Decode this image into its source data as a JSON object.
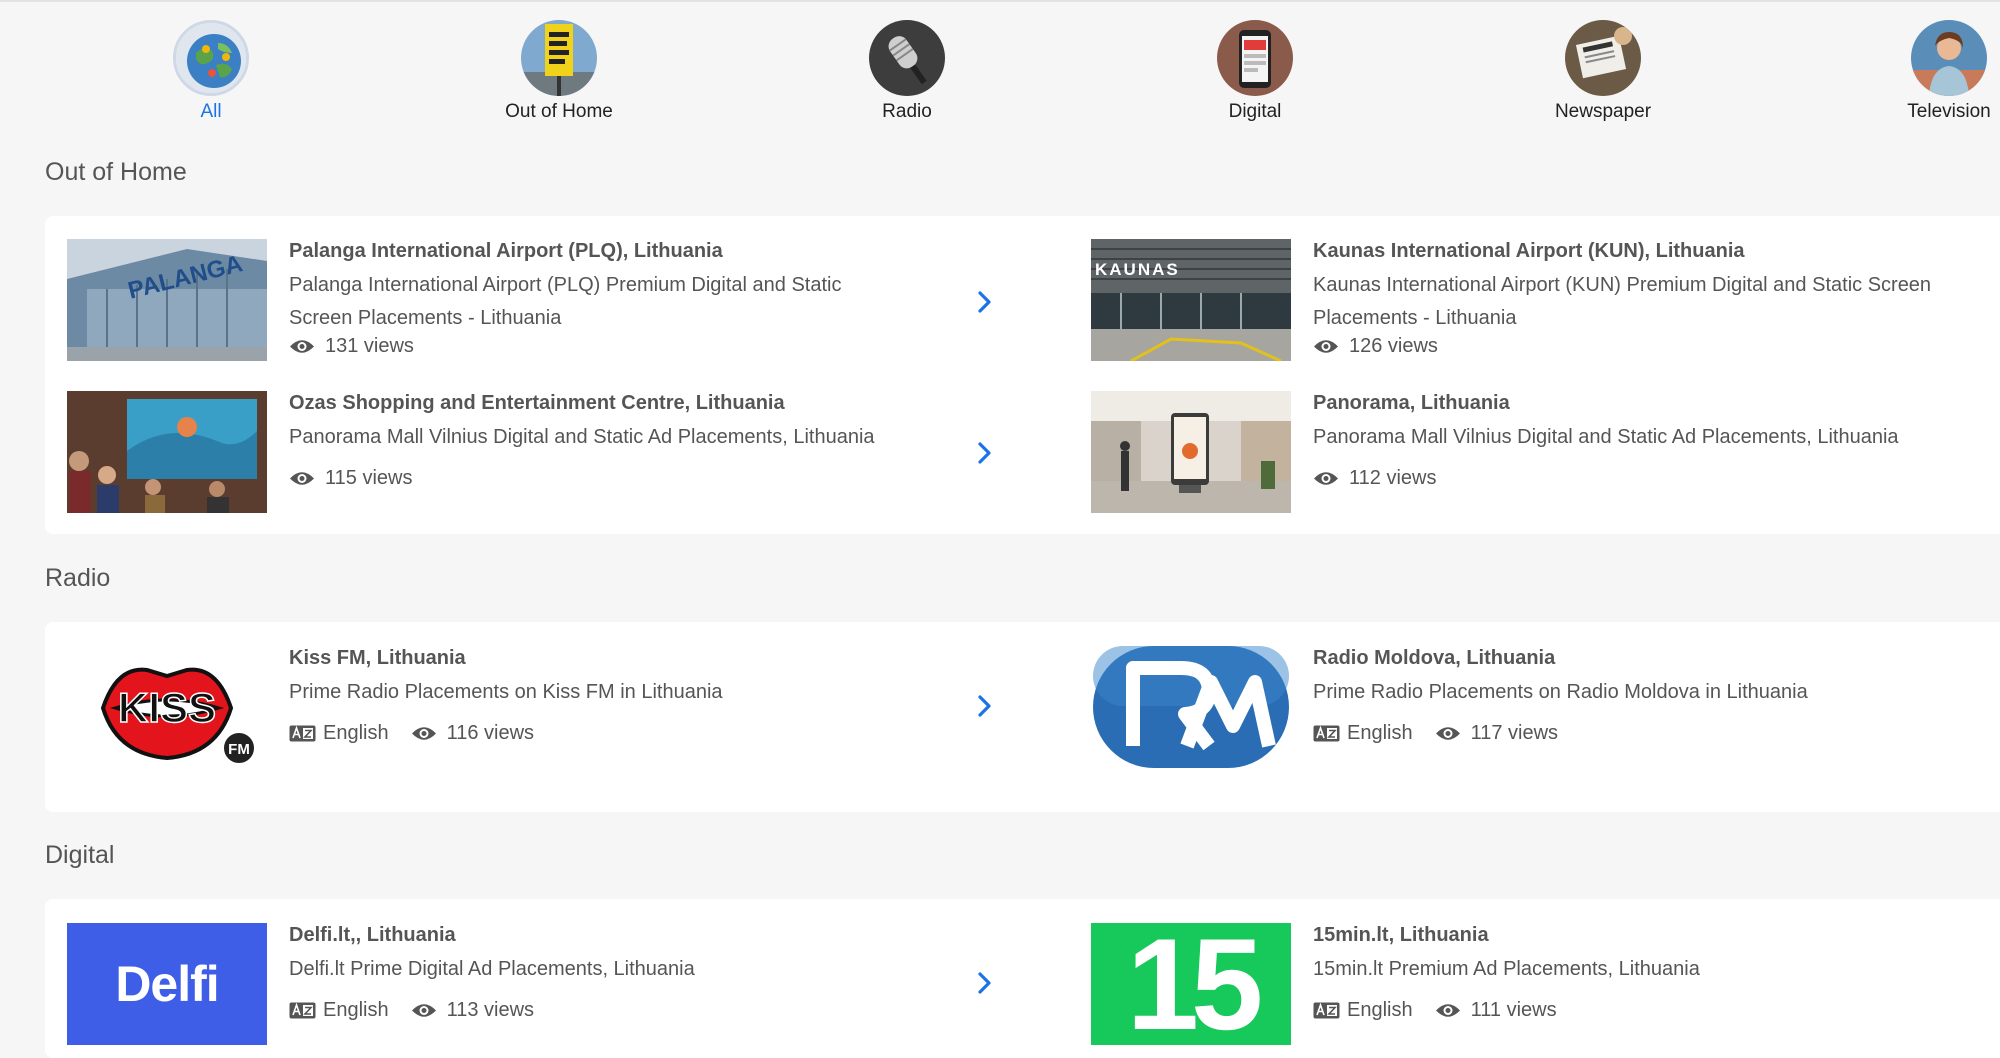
{
  "categories": [
    {
      "label": "All",
      "icon": "globe-icon",
      "active": true
    },
    {
      "label": "Out of Home",
      "icon": "billboard-icon",
      "active": false
    },
    {
      "label": "Radio",
      "icon": "microphone-icon",
      "active": false
    },
    {
      "label": "Digital",
      "icon": "phone-icon",
      "active": false
    },
    {
      "label": "Newspaper",
      "icon": "newspaper-icon",
      "active": false
    },
    {
      "label": "Television",
      "icon": "tv-presenter-icon",
      "active": false
    }
  ],
  "sections": {
    "ooh": {
      "title": "Out of Home",
      "items": [
        {
          "title": "Palanga International Airport (PLQ), Lithuania",
          "desc": "Palanga International Airport (PLQ) Premium Digital and Static Screen Placements - Lithuania",
          "views": "131 views",
          "image_text": "PALANGA"
        },
        {
          "title": "Kaunas International Airport (KUN), Lithuania",
          "desc": "Kaunas International Airport (KUN) Premium Digital and Static Screen Placements - Lithuania",
          "views": "126 views",
          "image_text": "KAUNAS"
        },
        {
          "title": "Ozas Shopping and Entertainment Centre, Lithuania",
          "desc": "Panorama Mall Vilnius Digital and Static Ad Placements, Lithuania",
          "views": "115 views"
        },
        {
          "title": "Panorama, Lithuania",
          "desc": "Panorama Mall Vilnius Digital and Static Ad Placements, Lithuania",
          "views": "112 views"
        }
      ]
    },
    "radio": {
      "title": "Radio",
      "items": [
        {
          "title": "Kiss FM, Lithuania",
          "desc": "Prime Radio Placements on Kiss FM in Lithuania",
          "language": "English",
          "views": "116 views",
          "logo_text": "KISS",
          "logo_badge": "FM"
        },
        {
          "title": "Radio Moldova, Lithuania",
          "desc": "Prime Radio Placements on Radio Moldova in Lithuania",
          "language": "English",
          "views": "117 views"
        }
      ]
    },
    "digital": {
      "title": "Digital",
      "items": [
        {
          "title": "Delfi.lt,, Lithuania",
          "desc": "Delfi.lt Prime Digital Ad Placements, Lithuania",
          "language": "English",
          "views": "113 views",
          "logo_text": "Delfi"
        },
        {
          "title": "15min.lt, Lithuania",
          "desc": "15min.lt Premium Ad Placements, Lithuania",
          "language": "English",
          "views": "111 views",
          "logo_text": "15"
        }
      ]
    }
  },
  "colors": {
    "accent": "#1a73e8",
    "delfi_blue": "#3f5ee8",
    "fifteen_green": "#17c95a",
    "kiss_red": "#e3141b",
    "radio_moldova_blue": "#2a6db5"
  }
}
